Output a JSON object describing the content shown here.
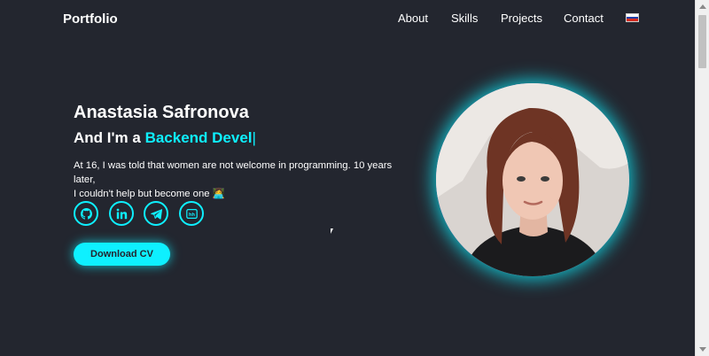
{
  "navbar": {
    "logo": "Portfolio",
    "items": [
      {
        "label": "About"
      },
      {
        "label": "Skills"
      },
      {
        "label": "Projects"
      },
      {
        "label": "Contact"
      }
    ],
    "language_flag": "russian-flag-icon"
  },
  "hero": {
    "name": "Anastasia Safronova",
    "role_prefix": "And I'm a",
    "role_typed": "Backend Devel",
    "caret": "|",
    "intro_line1": "At 16, I was told that women are not welcome in programming. 10 years later,",
    "intro_line2": "I couldn't help but become one 👩‍💻",
    "socials": [
      {
        "icon": "github-icon"
      },
      {
        "icon": "linkedin-icon"
      },
      {
        "icon": "telegram-icon"
      },
      {
        "icon": "hh-icon",
        "text": "hh"
      }
    ],
    "cv_button": "Download CV",
    "portrait": "profile-photo"
  },
  "colors": {
    "background": "#23262f",
    "accent": "#0ef0ff",
    "text": "#ffffff",
    "avatar_gradient_start": "#b13cff",
    "avatar_gradient_end": "#12c8ff"
  }
}
